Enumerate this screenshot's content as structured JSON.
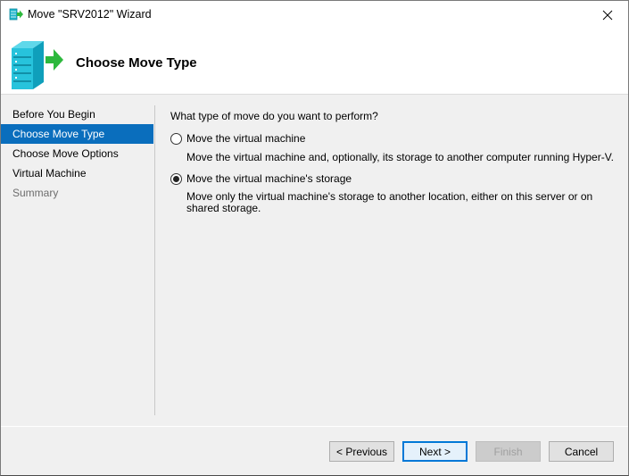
{
  "window": {
    "title": "Move \"SRV2012\" Wizard"
  },
  "header": {
    "title": "Choose Move Type"
  },
  "nav": {
    "items": [
      {
        "label": "Before You Begin",
        "state": "normal"
      },
      {
        "label": "Choose Move Type",
        "state": "active"
      },
      {
        "label": "Choose Move Options",
        "state": "normal"
      },
      {
        "label": "Virtual Machine",
        "state": "normal"
      },
      {
        "label": "Summary",
        "state": "disabled"
      }
    ]
  },
  "content": {
    "question": "What type of move do you want to perform?",
    "options": [
      {
        "label": "Move the virtual machine",
        "description": "Move the virtual machine and, optionally, its storage to another computer running Hyper-V.",
        "checked": false
      },
      {
        "label": "Move the virtual machine's storage",
        "description": "Move only the virtual machine's storage to another location, either on this server or on shared storage.",
        "checked": true
      }
    ]
  },
  "buttons": {
    "previous": "< Previous",
    "next": "Next >",
    "finish": "Finish",
    "cancel": "Cancel"
  },
  "colors": {
    "accent": "#0a6ebd",
    "default_button_border": "#0078d7"
  }
}
